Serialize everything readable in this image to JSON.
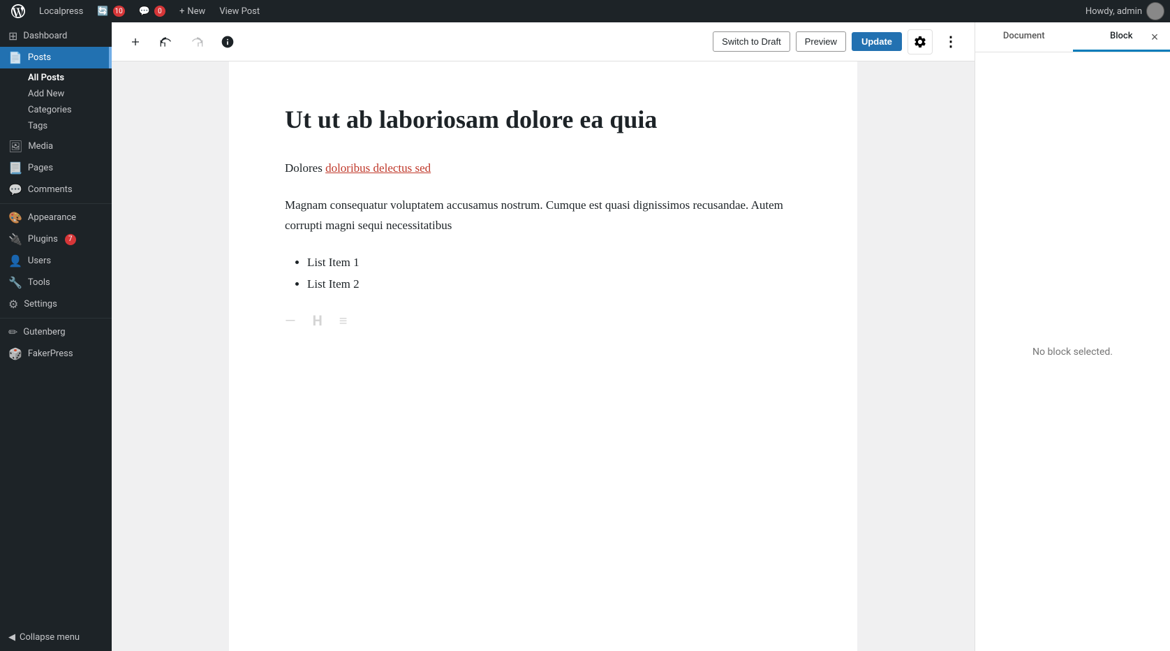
{
  "adminBar": {
    "siteName": "Localpress",
    "wpIconUnicode": "⊕",
    "updates": {
      "count": "10",
      "icon": "🔄"
    },
    "comments": {
      "count": "0",
      "icon": "💬"
    },
    "new": {
      "label": "New"
    },
    "viewPost": {
      "label": "View Post"
    },
    "howdy": "Howdy, admin"
  },
  "sidebar": {
    "items": [
      {
        "label": "Dashboard",
        "icon": "⊞"
      },
      {
        "label": "Posts",
        "icon": "📄",
        "active": true
      },
      {
        "label": "Media",
        "icon": "🖼"
      },
      {
        "label": "Pages",
        "icon": "📃"
      },
      {
        "label": "Comments",
        "icon": "💬"
      },
      {
        "label": "Appearance",
        "icon": "🎨"
      },
      {
        "label": "Plugins",
        "icon": "🔌",
        "badge": "7"
      },
      {
        "label": "Users",
        "icon": "👤"
      },
      {
        "label": "Tools",
        "icon": "🔧"
      },
      {
        "label": "Settings",
        "icon": "⚙"
      },
      {
        "label": "Gutenberg",
        "icon": "✏"
      },
      {
        "label": "FakerPress",
        "icon": "🎲"
      }
    ],
    "subItems": [
      {
        "label": "All Posts",
        "active": true
      },
      {
        "label": "Add New"
      },
      {
        "label": "Categories"
      },
      {
        "label": "Tags"
      }
    ],
    "collapseLabel": "Collapse menu"
  },
  "toolbar": {
    "addBlockLabel": "+",
    "undoLabel": "↩",
    "redoLabel": "↪",
    "infoLabel": "ℹ",
    "switchToDraftLabel": "Switch to Draft",
    "previewLabel": "Preview",
    "updateLabel": "Update"
  },
  "editor": {
    "title": "Ut ut ab laboriosam dolore ea quia",
    "paragraphs": [
      {
        "html": "Dolores <span class='post-link'>doloribus delectus sed</span>"
      },
      {
        "text": "Magnam consequatur voluptatem accusamus nostrum. Cumque est quasi dignissimos recusandae. Autem corrupti magni sequi necessitatibus"
      }
    ],
    "listItems": [
      "List Item 1",
      "List Item 2"
    ]
  },
  "rightPanel": {
    "tabs": [
      {
        "label": "Document"
      },
      {
        "label": "Block",
        "active": true
      }
    ],
    "noBlockSelected": "No block selected."
  }
}
